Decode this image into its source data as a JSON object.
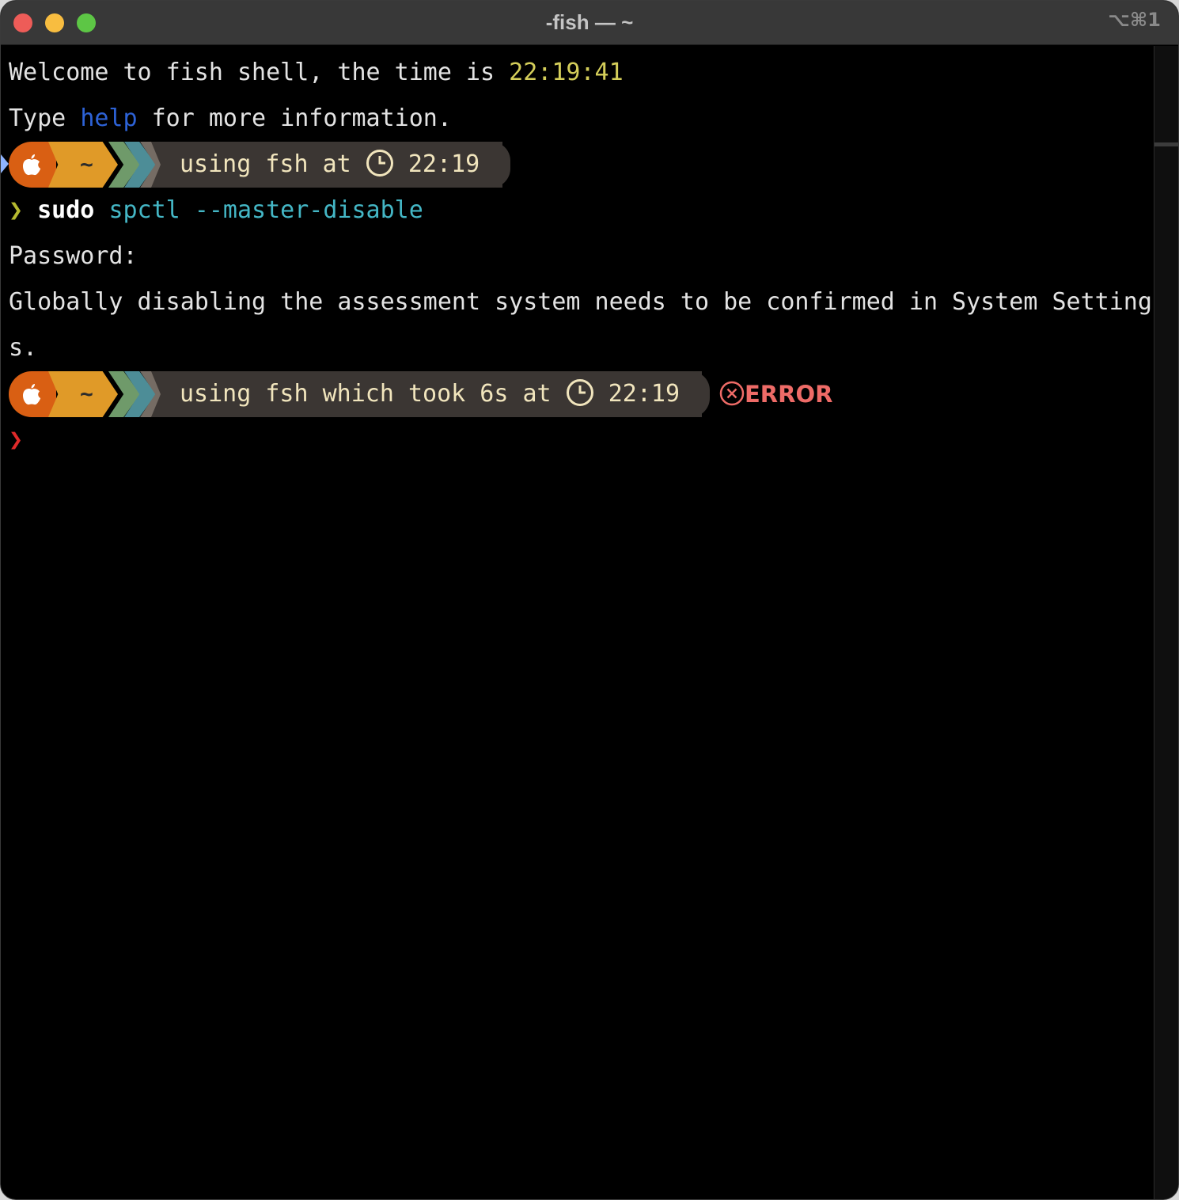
{
  "window": {
    "title": "-fish — ~",
    "shortcut": "⌥⌘1"
  },
  "terminal": {
    "welcome": {
      "prefix": "Welcome to fish shell, the time is ",
      "time": "22:19:41"
    },
    "type_help": {
      "prefix": "Type ",
      "help": "help",
      "suffix": " for more information."
    },
    "prompt1": {
      "dir": "~",
      "info_prefix": "using fsh at ",
      "time": "22:19"
    },
    "command": {
      "arrow": "❯",
      "cmd": "sudo",
      "args": "spctl --master-disable"
    },
    "output": [
      "Password:",
      "Globally disabling the assessment system needs to be confirmed in System Setting",
      "s."
    ],
    "prompt2": {
      "dir": "~",
      "info_prefix": "using fsh which took 6s at ",
      "time": "22:19",
      "status": "ERROR"
    },
    "current_prompt": {
      "arrow": "❯"
    }
  },
  "colors": {
    "apple_segment": "#d95f13",
    "dir_segment": "#e09a28",
    "info_segment": "#3b3633",
    "error": "#ee6b67"
  }
}
